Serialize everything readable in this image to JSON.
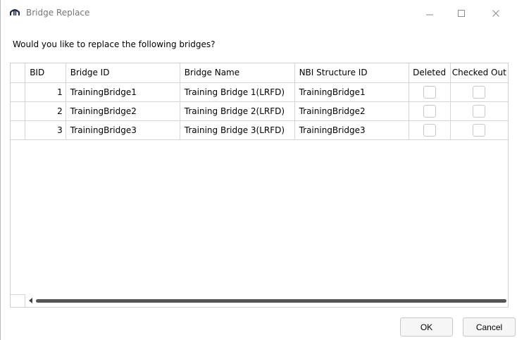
{
  "window": {
    "title": "Bridge Replace",
    "icon": "bridge-icon",
    "controls": [
      "minimize-icon",
      "maximize-icon",
      "close-icon"
    ]
  },
  "prompt": "Would you like to replace the following bridges?",
  "table": {
    "columns": [
      "BID",
      "Bridge ID",
      "Bridge Name",
      "NBI Structure ID",
      "Deleted",
      "Checked Out"
    ],
    "rows": [
      {
        "bid": "1",
        "bridge_id": "TrainingBridge1",
        "bridge_name": "Training Bridge 1(LRFD)",
        "nbi_id": "TrainingBridge1",
        "deleted": false,
        "checked_out": false
      },
      {
        "bid": "2",
        "bridge_id": "TrainingBridge2",
        "bridge_name": "Training Bridge 2(LRFD)",
        "nbi_id": "TrainingBridge2",
        "deleted": false,
        "checked_out": false
      },
      {
        "bid": "3",
        "bridge_id": "TrainingBridge3",
        "bridge_name": "Training Bridge 3(LRFD)",
        "nbi_id": "TrainingBridge3",
        "deleted": false,
        "checked_out": false
      }
    ]
  },
  "buttons": {
    "ok": "OK",
    "cancel": "Cancel"
  }
}
